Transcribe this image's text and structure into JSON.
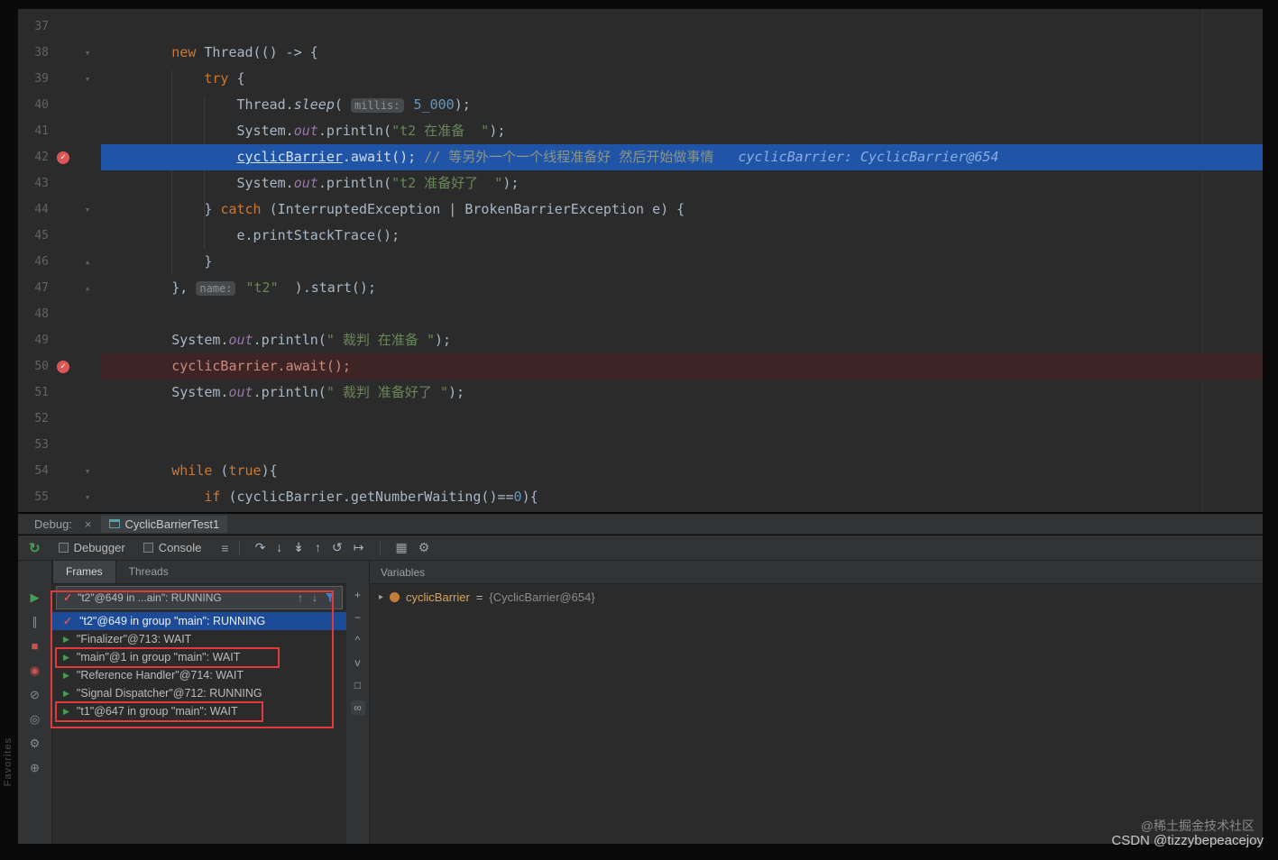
{
  "colors": {
    "exec_line": "#2054a6",
    "breakpoint_line": "#3f2426",
    "selected_row": "#1d4b97",
    "annotation": "#e03a3a",
    "resume_green": "#499c54",
    "breakpoint_red": "#db5756"
  },
  "editor": {
    "lines": [
      {
        "num": "37",
        "segs": []
      },
      {
        "num": "38",
        "fold": "down",
        "segs": [
          {
            "t": "        ",
            "s": "p"
          },
          {
            "t": "new",
            "s": "k"
          },
          {
            "t": " Thread(() -> {",
            "s": "p"
          }
        ]
      },
      {
        "num": "39",
        "fold": "down",
        "segs": [
          {
            "t": "            ",
            "s": "p"
          },
          {
            "t": "try",
            "s": "k"
          },
          {
            "t": " {",
            "s": "p"
          }
        ]
      },
      {
        "num": "40",
        "segs": [
          {
            "t": "                Thread.",
            "s": "p"
          },
          {
            "t": "sleep",
            "s": "m"
          },
          {
            "t": "( ",
            "s": "p"
          },
          {
            "t": "millis:",
            "s": "h"
          },
          {
            "t": " ",
            "s": "p"
          },
          {
            "t": "5_000",
            "s": "n"
          },
          {
            "t": ");",
            "s": "p"
          }
        ]
      },
      {
        "num": "41",
        "segs": [
          {
            "t": "                System.",
            "s": "p"
          },
          {
            "t": "out",
            "s": "f"
          },
          {
            "t": ".println(",
            "s": "p"
          },
          {
            "t": "\"t2 在准备  \"",
            "s": "str"
          },
          {
            "t": ");",
            "s": "p"
          }
        ]
      },
      {
        "num": "42",
        "bg": "exec",
        "bp": true,
        "segs": [
          {
            "t": "                ",
            "s": "p"
          },
          {
            "t": "cyclicBarrier",
            "s": "u"
          },
          {
            "t": ".await(); ",
            "s": "p"
          },
          {
            "t": "// 等另外一个一个线程准备好 然后开始做事情",
            "s": "c"
          },
          {
            "t": "   ",
            "s": "p"
          },
          {
            "t": "cyclicBarrier: CyclicBarrier@654",
            "s": "d"
          }
        ]
      },
      {
        "num": "43",
        "segs": [
          {
            "t": "                System.",
            "s": "p"
          },
          {
            "t": "out",
            "s": "f"
          },
          {
            "t": ".println(",
            "s": "p"
          },
          {
            "t": "\"t2 准备好了  \"",
            "s": "str"
          },
          {
            "t": ");",
            "s": "p"
          }
        ]
      },
      {
        "num": "44",
        "fold": "down",
        "segs": [
          {
            "t": "            } ",
            "s": "p"
          },
          {
            "t": "catch",
            "s": "k"
          },
          {
            "t": " (InterruptedException | BrokenBarrierException e) {",
            "s": "p"
          }
        ]
      },
      {
        "num": "45",
        "segs": [
          {
            "t": "                e.printStackTrace();",
            "s": "p"
          }
        ]
      },
      {
        "num": "46",
        "fold": "up",
        "segs": [
          {
            "t": "            }",
            "s": "p"
          }
        ]
      },
      {
        "num": "47",
        "fold": "up",
        "segs": [
          {
            "t": "        }, ",
            "s": "p"
          },
          {
            "t": "name:",
            "s": "h"
          },
          {
            "t": " ",
            "s": "p"
          },
          {
            "t": "\"t2\"",
            "s": "str"
          },
          {
            "t": "  ).start();",
            "s": "p"
          }
        ]
      },
      {
        "num": "48",
        "segs": []
      },
      {
        "num": "49",
        "segs": [
          {
            "t": "        System.",
            "s": "p"
          },
          {
            "t": "out",
            "s": "f"
          },
          {
            "t": ".println(",
            "s": "p"
          },
          {
            "t": "\" 裁判 在准备 \"",
            "s": "str"
          },
          {
            "t": ");",
            "s": "p"
          }
        ]
      },
      {
        "num": "50",
        "bg": "bp",
        "bp": true,
        "segs": [
          {
            "t": "        ",
            "s": "p"
          },
          {
            "t": "cyclicBarrier.await();",
            "s": "w"
          }
        ]
      },
      {
        "num": "51",
        "segs": [
          {
            "t": "        System.",
            "s": "p"
          },
          {
            "t": "out",
            "s": "f"
          },
          {
            "t": ".println(",
            "s": "p"
          },
          {
            "t": "\" 裁判 准备好了 \"",
            "s": "str"
          },
          {
            "t": ");",
            "s": "p"
          }
        ]
      },
      {
        "num": "52",
        "segs": []
      },
      {
        "num": "53",
        "segs": []
      },
      {
        "num": "54",
        "fold": "down",
        "segs": [
          {
            "t": "        ",
            "s": "p"
          },
          {
            "t": "while",
            "s": "k"
          },
          {
            "t": " (",
            "s": "p"
          },
          {
            "t": "true",
            "s": "k"
          },
          {
            "t": "){",
            "s": "p"
          }
        ]
      },
      {
        "num": "55",
        "fold": "down",
        "segs": [
          {
            "t": "            ",
            "s": "p"
          },
          {
            "t": "if",
            "s": "k"
          },
          {
            "t": " (cyclicBarrier.getNumberWaiting()==",
            "s": "p"
          },
          {
            "t": "0",
            "s": "n"
          },
          {
            "t": "){",
            "s": "p"
          }
        ]
      }
    ]
  },
  "debugbar": {
    "label": "Debug:",
    "close": "×",
    "session": "CyclicBarrierTest1"
  },
  "toolbar": {
    "rerun": {
      "g": "↻",
      "n": "rerun-icon"
    },
    "tabs": [
      {
        "label": "Debugger",
        "n": "tab-debugger"
      },
      {
        "label": "Console",
        "n": "tab-console"
      }
    ],
    "menu": {
      "g": "≡",
      "n": "layout-menu-icon"
    },
    "steps": [
      {
        "g": "↷",
        "n": "step-over-icon"
      },
      {
        "g": "↓",
        "n": "step-into-icon"
      },
      {
        "g": "↡",
        "n": "force-step-into-icon"
      },
      {
        "g": "↑",
        "n": "step-out-icon"
      },
      {
        "g": "↺",
        "n": "drop-frame-icon"
      },
      {
        "g": "↦",
        "n": "run-to-cursor-icon"
      }
    ],
    "extras": [
      {
        "g": "▦",
        "n": "evaluate-expression-icon"
      },
      {
        "g": "⚙",
        "n": "debug-settings-icon"
      }
    ]
  },
  "leftbar": {
    "icons": [
      {
        "g": "▶",
        "c": "#499c54",
        "n": "resume-icon"
      },
      {
        "g": "∥",
        "c": "#8a8d90",
        "n": "pause-icon"
      },
      {
        "g": "■",
        "c": "#c75450",
        "n": "stop-icon"
      },
      {
        "g": "◉",
        "c": "#c75450",
        "n": "view-breakpoints-icon"
      },
      {
        "g": "⊘",
        "c": "#8a8d90",
        "n": "mute-breakpoints-icon"
      },
      {
        "g": "◎",
        "c": "#8a8d90",
        "n": "thread-dump-icon"
      },
      {
        "g": "⚙",
        "c": "#8a8d90",
        "n": "settings-icon"
      },
      {
        "g": "⊕",
        "c": "#8a8d90",
        "n": "pin-icon"
      }
    ]
  },
  "frames": {
    "tabs": [
      "Frames",
      "Threads"
    ],
    "dropdown": {
      "check": "✓",
      "text": "\"t2\"@649 in ...ain\": RUNNING",
      "up": "↑",
      "down": "↓"
    },
    "threads": [
      {
        "icon": "check",
        "text": "\"t2\"@649 in group \"main\": RUNNING",
        "selected": true
      },
      {
        "icon": "run",
        "text": "\"Finalizer\"@713: WAIT"
      },
      {
        "icon": "run",
        "text": "\"main\"@1 in group \"main\": WAIT",
        "boxed": true
      },
      {
        "icon": "run",
        "text": "\"Reference Handler\"@714: WAIT"
      },
      {
        "icon": "run",
        "text": "\"Signal Dispatcher\"@712: RUNNING"
      },
      {
        "icon": "run",
        "text": "\"t1\"@647 in group \"main\": WAIT",
        "boxed": true
      }
    ]
  },
  "midbar": {
    "icons": [
      {
        "g": "+",
        "n": "add-icon"
      },
      {
        "g": "−",
        "n": "remove-icon"
      },
      {
        "g": "^",
        "n": "chevron-up-icon"
      },
      {
        "g": "v",
        "n": "chevron-down-icon"
      },
      {
        "g": "□",
        "n": "copy-icon"
      },
      {
        "g": "∞",
        "n": "infinity-watches-icon",
        "boxed": true
      }
    ]
  },
  "variables": {
    "header": "Variables",
    "rows": [
      {
        "chevron": "▸",
        "name": "cyclicBarrier",
        "eq": " = ",
        "value": "{CyclicBarrier@654}"
      }
    ]
  },
  "watermarks": {
    "line1": "@稀土掘金技术社区",
    "line2": "CSDN @tizzybepeacejoy"
  },
  "favorites_label": "Favorites"
}
